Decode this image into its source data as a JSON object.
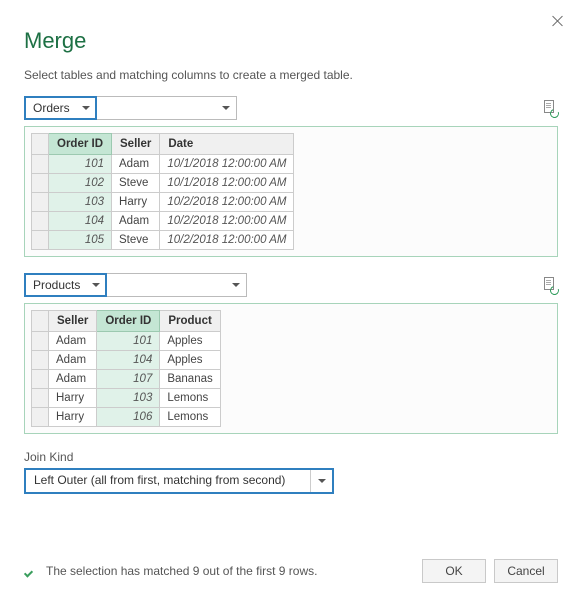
{
  "dialog": {
    "title": "Merge",
    "instruction": "Select tables and matching columns to create a merged table."
  },
  "table1": {
    "name": "Orders",
    "columns": [
      "Order ID",
      "Seller",
      "Date"
    ],
    "selectedColumnIndex": 0,
    "rows": [
      {
        "order_id": "101",
        "seller": "Adam",
        "date": "10/1/2018 12:00:00 AM"
      },
      {
        "order_id": "102",
        "seller": "Steve",
        "date": "10/1/2018 12:00:00 AM"
      },
      {
        "order_id": "103",
        "seller": "Harry",
        "date": "10/2/2018 12:00:00 AM"
      },
      {
        "order_id": "104",
        "seller": "Adam",
        "date": "10/2/2018 12:00:00 AM"
      },
      {
        "order_id": "105",
        "seller": "Steve",
        "date": "10/2/2018 12:00:00 AM"
      }
    ]
  },
  "table2": {
    "name": "Products",
    "columns": [
      "Seller",
      "Order ID",
      "Product"
    ],
    "selectedColumnIndex": 1,
    "rows": [
      {
        "seller": "Adam",
        "order_id": "101",
        "product": "Apples"
      },
      {
        "seller": "Adam",
        "order_id": "104",
        "product": "Apples"
      },
      {
        "seller": "Adam",
        "order_id": "107",
        "product": "Bananas"
      },
      {
        "seller": "Harry",
        "order_id": "103",
        "product": "Lemons"
      },
      {
        "seller": "Harry",
        "order_id": "106",
        "product": "Lemons"
      }
    ]
  },
  "join": {
    "label": "Join Kind",
    "value": "Left Outer (all from first, matching from second)"
  },
  "status": {
    "text": "The selection has matched 9 out of the first 9 rows."
  },
  "buttons": {
    "ok": "OK",
    "cancel": "Cancel"
  }
}
